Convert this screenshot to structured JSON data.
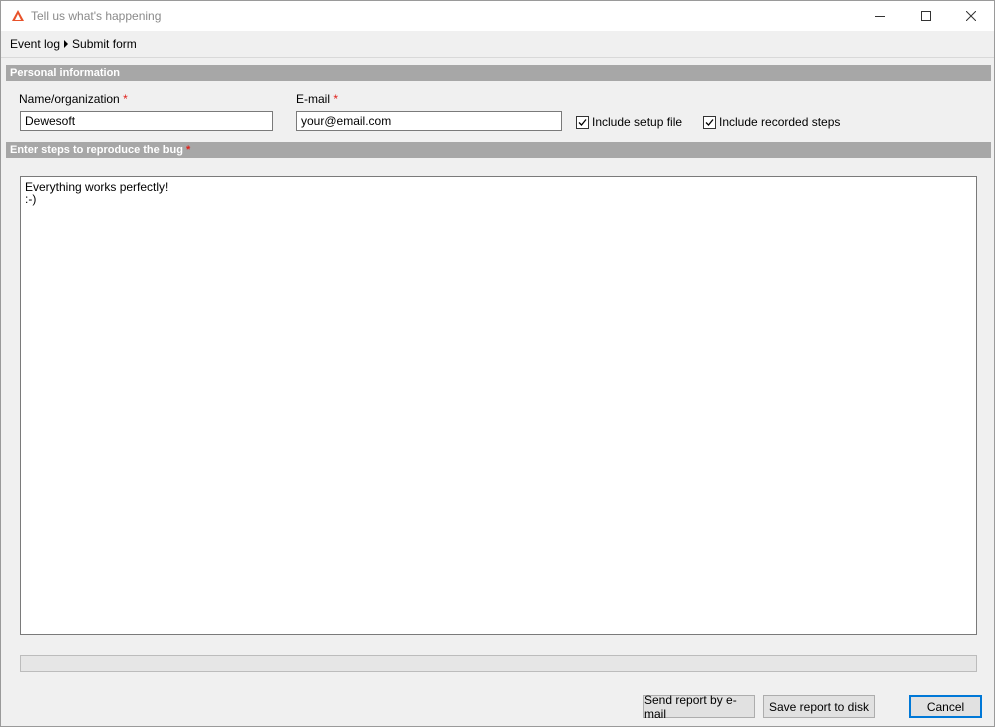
{
  "window": {
    "title": "Tell us what's happening",
    "accent_color": "#e8522a"
  },
  "breadcrumb": {
    "items": [
      "Event log",
      "Submit form"
    ]
  },
  "personal_info": {
    "header": "Personal information",
    "name_label": "Name/organization",
    "name_value": "Dewesoft",
    "email_label": "E-mail",
    "email_value": "your@email.com",
    "required_mark": "*",
    "include_setup_label": "Include setup file",
    "include_setup_checked": true,
    "include_steps_label": "Include recorded steps",
    "include_steps_checked": true
  },
  "steps": {
    "header": "Enter steps to reproduce the bug",
    "text": "Everything works perfectly!\n:-)"
  },
  "progress": {
    "value": 0
  },
  "buttons": {
    "send_email": "Send report by e-mail",
    "save_disk": "Save report to disk",
    "cancel": "Cancel"
  }
}
